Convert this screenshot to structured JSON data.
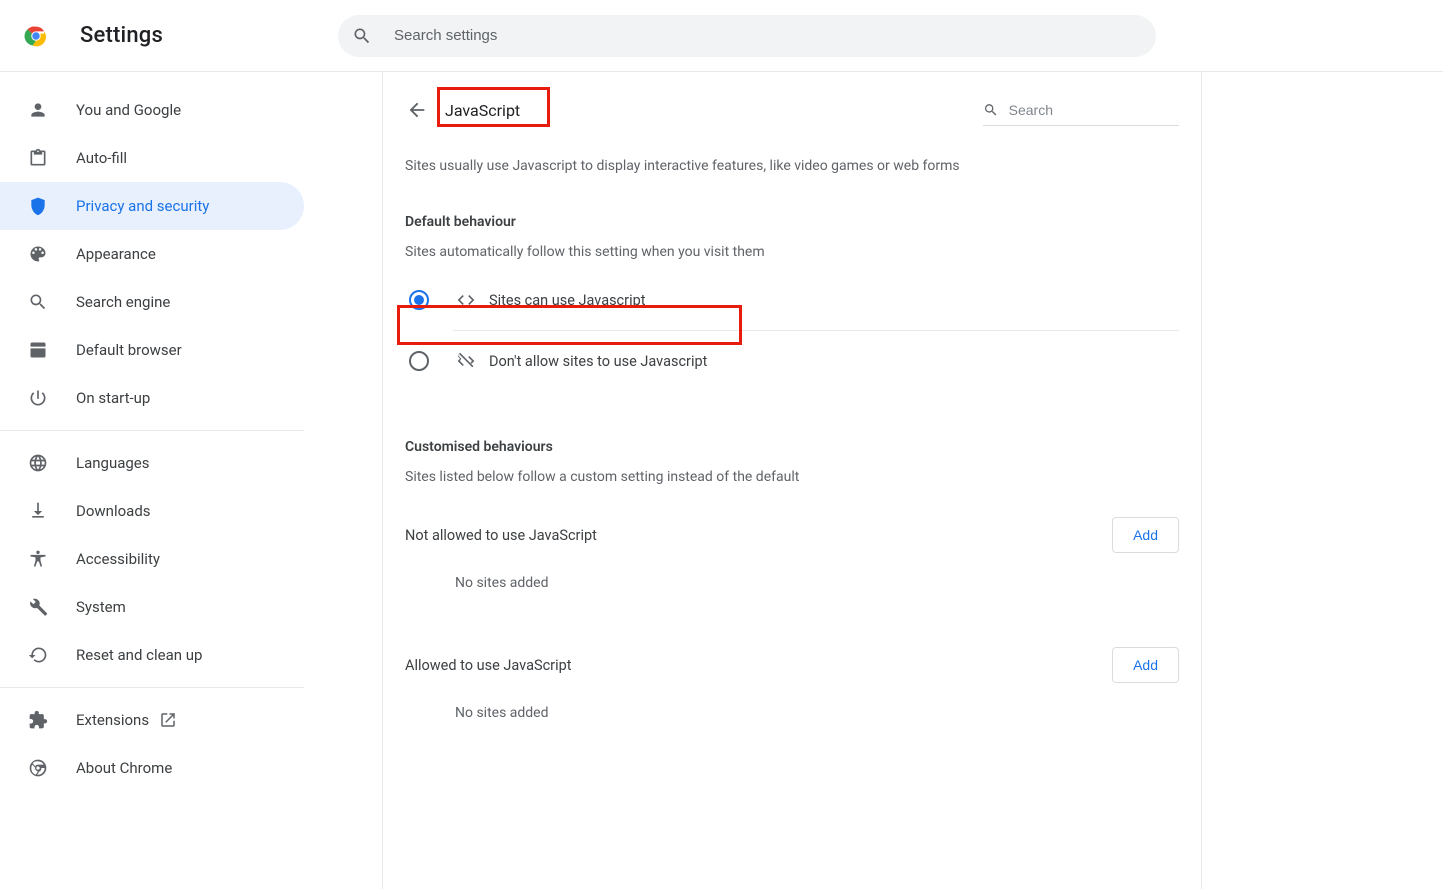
{
  "app": {
    "title": "Settings",
    "search_placeholder": "Search settings"
  },
  "sidebar": {
    "items": [
      {
        "label": "You and Google"
      },
      {
        "label": "Auto-fill"
      },
      {
        "label": "Privacy and security"
      },
      {
        "label": "Appearance"
      },
      {
        "label": "Search engine"
      },
      {
        "label": "Default browser"
      },
      {
        "label": "On start-up"
      }
    ],
    "items2": [
      {
        "label": "Languages"
      },
      {
        "label": "Downloads"
      },
      {
        "label": "Accessibility"
      },
      {
        "label": "System"
      },
      {
        "label": "Reset and clean up"
      }
    ],
    "items3": [
      {
        "label": "Extensions"
      },
      {
        "label": "About Chrome"
      }
    ]
  },
  "page": {
    "title": "JavaScript",
    "inline_search_placeholder": "Search",
    "description": "Sites usually use Javascript to display interactive features, like video games or web forms",
    "default_title": "Default behaviour",
    "default_sub": "Sites automatically follow this setting when you visit them",
    "radio_allow": "Sites can use Javascript",
    "radio_block": "Don't allow sites to use Javascript",
    "custom_title": "Customised behaviours",
    "custom_sub": "Sites listed below follow a custom setting instead of the default",
    "not_allowed_label": "Not allowed to use JavaScript",
    "allowed_label": "Allowed to use JavaScript",
    "add_label": "Add",
    "no_sites": "No sites added"
  }
}
